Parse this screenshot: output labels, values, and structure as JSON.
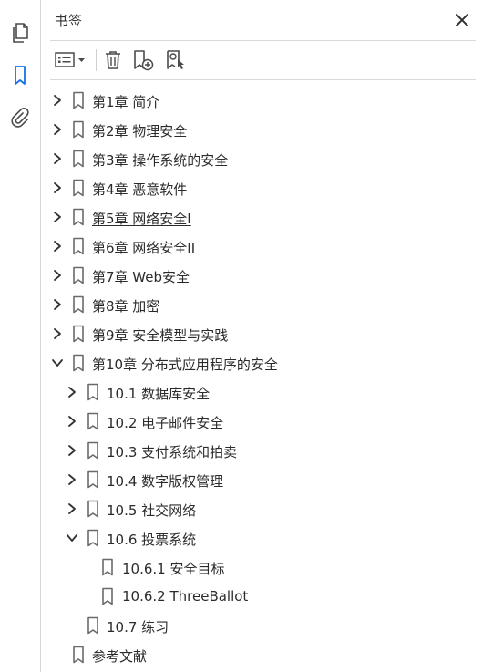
{
  "panel": {
    "title": "书签"
  },
  "rail": {
    "items": [
      {
        "name": "pages-icon"
      },
      {
        "name": "bookmark-icon",
        "active": true
      },
      {
        "name": "attachment-icon"
      }
    ]
  },
  "toolbar": {
    "buttons": [
      "options-menu-icon",
      "delete-bookmark-icon",
      "new-bookmark-icon",
      "find-current-bookmark-icon"
    ]
  },
  "colors": {
    "accent": "#1473e6",
    "icon": "#4b4b4b",
    "divider": "#d9d9d9"
  },
  "bookmarks": [
    {
      "label": "第1章 简介",
      "level": 0,
      "state": "collapsed"
    },
    {
      "label": "第2章 物理安全",
      "level": 0,
      "state": "collapsed"
    },
    {
      "label": "第3章 操作系统的安全",
      "level": 0,
      "state": "collapsed"
    },
    {
      "label": "第4章 恶意软件",
      "level": 0,
      "state": "collapsed"
    },
    {
      "label": "第5章 网络安全I",
      "level": 0,
      "state": "collapsed",
      "underlined": true
    },
    {
      "label": "第6章 网络安全II",
      "level": 0,
      "state": "collapsed"
    },
    {
      "label": "第7章 Web安全",
      "level": 0,
      "state": "collapsed"
    },
    {
      "label": "第8章 加密",
      "level": 0,
      "state": "collapsed"
    },
    {
      "label": "第9章 安全模型与实践",
      "level": 0,
      "state": "collapsed"
    },
    {
      "label": "第10章 分布式应用程序的安全",
      "level": 0,
      "state": "expanded"
    },
    {
      "label": "10.1 数据库安全",
      "level": 1,
      "state": "collapsed"
    },
    {
      "label": "10.2 电子邮件安全",
      "level": 1,
      "state": "collapsed"
    },
    {
      "label": "10.3 支付系统和拍卖",
      "level": 1,
      "state": "collapsed"
    },
    {
      "label": "10.4 数字版权管理",
      "level": 1,
      "state": "collapsed"
    },
    {
      "label": "10.5 社交网络",
      "level": 1,
      "state": "collapsed"
    },
    {
      "label": "10.6 投票系统",
      "level": 1,
      "state": "expanded"
    },
    {
      "label": "10.6.1 安全目标",
      "level": 2,
      "state": "leaf"
    },
    {
      "label": "10.6.2 ThreeBallot",
      "level": 2,
      "state": "leaf"
    },
    {
      "label": "10.7 练习",
      "level": 1,
      "state": "leaf"
    },
    {
      "label": "参考文献",
      "level": 0,
      "state": "leaf"
    }
  ]
}
